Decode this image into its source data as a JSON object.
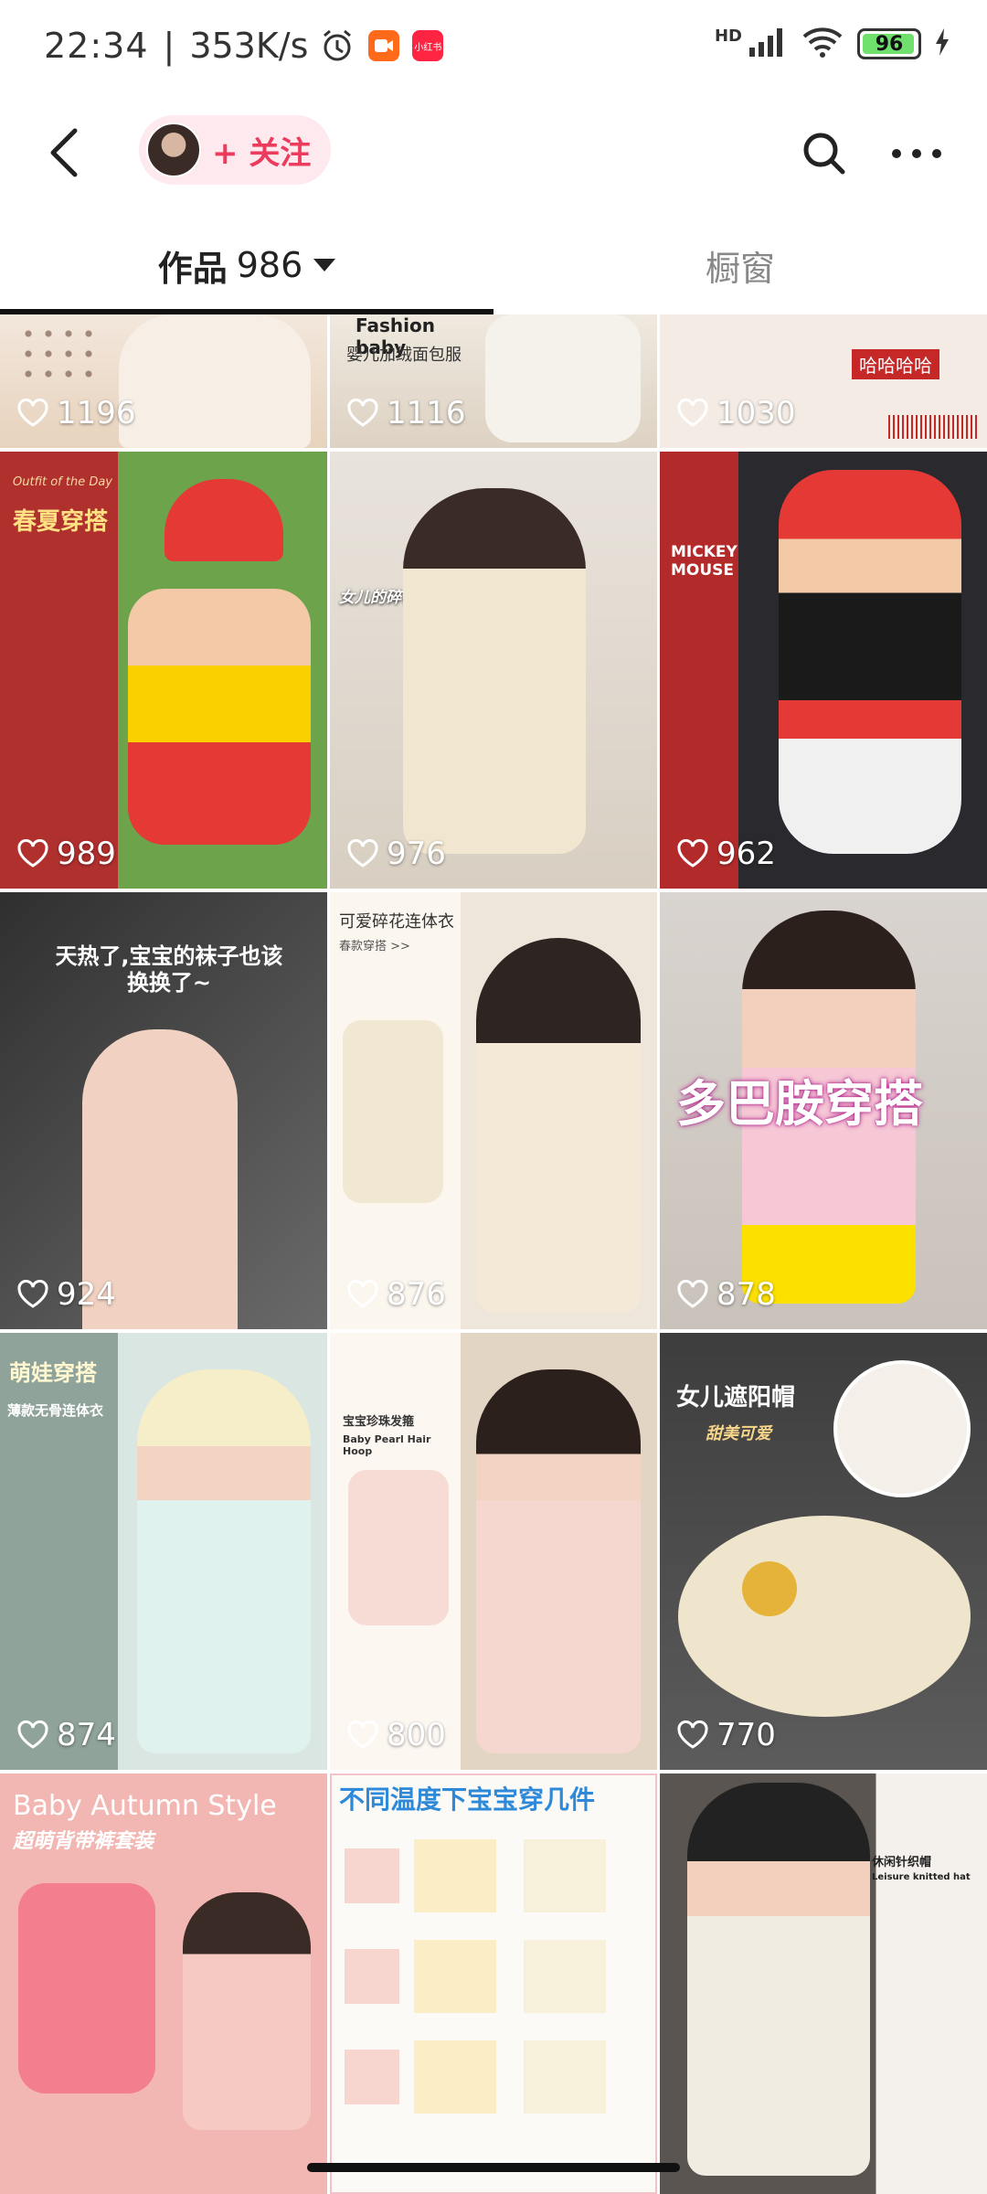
{
  "status_bar": {
    "time": "22:34",
    "separator": "|",
    "net_speed": "353K/s",
    "battery": "96",
    "battery_level": 0.96,
    "network_label": "HD",
    "notification_badge": "小红书"
  },
  "header": {
    "follow_label": "+ 关注"
  },
  "tabs": {
    "works_label": "作品",
    "works_count": "986",
    "showcase_label": "橱窗"
  },
  "posts": [
    {
      "likes": "1196"
    },
    {
      "likes": "1116",
      "caption": "婴儿加绒面包服",
      "brand": "Fashion baby"
    },
    {
      "likes": "1030",
      "caption": "哈哈哈哈"
    },
    {
      "likes": "989",
      "caption": "春夏穿搭",
      "sub": "Outfit of the Day"
    },
    {
      "likes": "976",
      "caption": "女儿的碎花连体衣好好看!"
    },
    {
      "likes": "962",
      "caption": "MICKEY MOUSE"
    },
    {
      "likes": "924",
      "caption": "天热了,宝宝的袜子也该换换了~"
    },
    {
      "likes": "876",
      "caption": "可爱碎花连体衣",
      "sub": "春款穿搭 >>"
    },
    {
      "likes": "878",
      "caption": "多巴胺穿搭"
    },
    {
      "likes": "874",
      "caption": "萌娃穿搭",
      "sub": "薄款无骨连体衣"
    },
    {
      "likes": "800",
      "caption": "宝宝珍珠发箍",
      "sub": "Baby Pearl Hair Hoop"
    },
    {
      "likes": "770",
      "caption": "女儿遮阳帽",
      "sub": "甜美可爱"
    },
    {
      "caption": "Baby Autumn Style",
      "sub": "超萌背带裤套装"
    },
    {
      "caption": "不同温度下宝宝穿几件"
    },
    {
      "caption": "休闲针织帽",
      "sub": "Leisure knitted hat"
    }
  ],
  "colors": {
    "accent": "#ec3b5c",
    "follow_bg": "#fde9ee",
    "battery_fill": "#6ee06b"
  }
}
